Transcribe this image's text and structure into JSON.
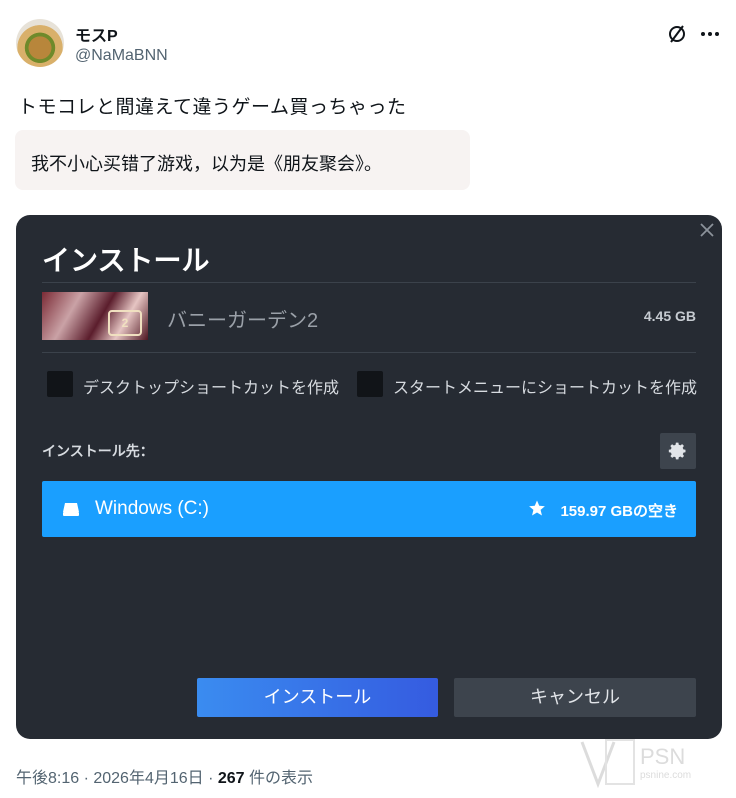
{
  "tweet": {
    "display_name": "モスP",
    "handle": "@NaMaBNN",
    "text": "トモコレと間違えて違うゲーム買っちゃった",
    "translation": "我不小心买错了游戏，以为是《朋友聚会》。",
    "footer_time": "午後8:16 · 2026年4月16日 · ",
    "footer_views_count": "267",
    "footer_views_label": " 件の表示"
  },
  "dialog": {
    "title": "インストール",
    "game_title": "バニーガーデン2",
    "game_size": "4.45 GB",
    "thumb_logo_text": "2",
    "checkbox_desktop_label": "デスクトップショートカットを作成",
    "checkbox_startmenu_label": "スタートメニューにショートカットを作成",
    "install_location_label": "インストール先：",
    "drive_name": "Windows (C:)",
    "free_space": "159.97 GBの空き",
    "install_button": "インストール",
    "cancel_button": "キャンセル"
  },
  "watermark": {
    "text": "PSN",
    "subtext": "psnine.com"
  },
  "icons": {
    "grok": "slashed-circle-icon",
    "more": "more-icon",
    "close": "close-icon",
    "gear": "gear-icon",
    "drive": "drive-icon",
    "star": "star-icon"
  },
  "colors": {
    "dialog_bg": "#262b33",
    "accent_blue": "#1a9fff",
    "install_button": "#355be0",
    "translation_bg": "#f7f3f2"
  }
}
